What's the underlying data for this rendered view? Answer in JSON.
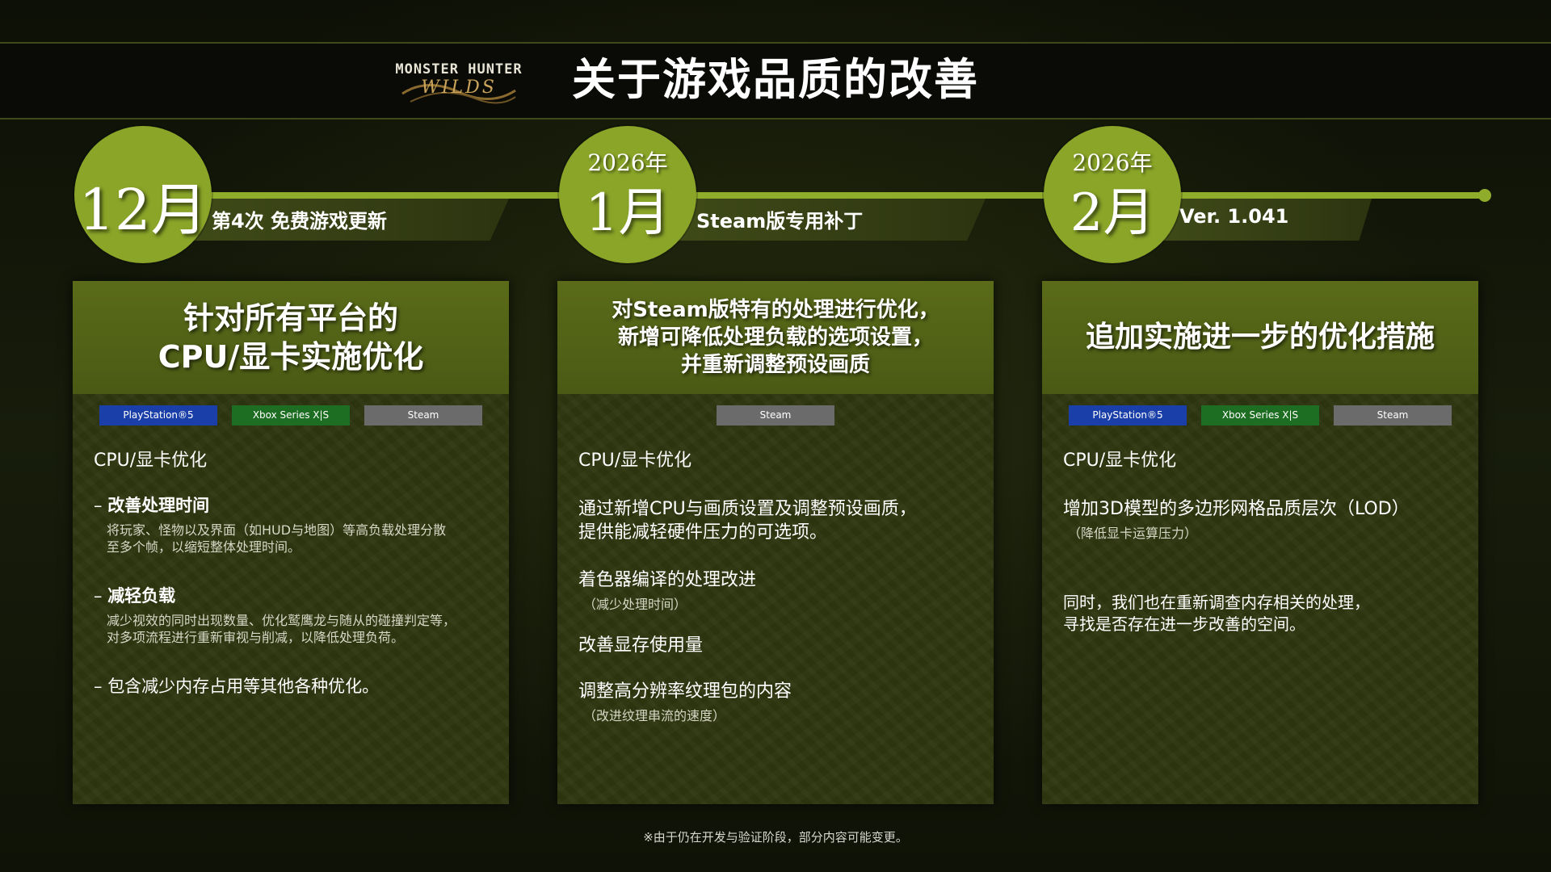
{
  "header": {
    "logo_line1": "MONSTER HUNTER",
    "logo_line2": "WILDS",
    "title": "关于游戏品质的改善"
  },
  "timeline": [
    {
      "year": "",
      "month": "12月",
      "label": "第4次 免费游戏更新"
    },
    {
      "year": "2026年",
      "month": "1月",
      "label": "Steam版专用补丁"
    },
    {
      "year": "2026年",
      "month": "2月",
      "label": "Ver. 1.041"
    }
  ],
  "panels": [
    {
      "heading_lines": [
        "针对所有平台的",
        "CPU/显卡实施优化"
      ],
      "tags": [
        "PlayStation®5",
        "Xbox Series X|S",
        "Steam"
      ],
      "section_title": "CPU/显卡优化",
      "items": [
        {
          "title": "改善处理时间",
          "desc_lines": [
            "将玩家、怪物以及界面（如HUD与地图）等高负载处理分散",
            "至多个帧，以缩短整体处理时间。"
          ]
        },
        {
          "title": "减轻负载",
          "desc_lines": [
            "减少视效的同时出现数量、优化鹫鹰龙与随从的碰撞判定等，",
            "对多项流程进行重新审视与削减，以降低处理负荷。"
          ]
        },
        {
          "title": "包含减少内存占用等其他各种优化。"
        }
      ]
    },
    {
      "heading_lines": [
        "对Steam版特有的处理进行优化，",
        "新增可降低处理负载的选项设置，",
        "并重新调整预设画质"
      ],
      "tags": [
        "Steam"
      ],
      "section_title": "CPU/显卡优化",
      "items": [
        {
          "lines": [
            "通过新增CPU与画质设置及调整预设画质，",
            "提供能减轻硬件压力的可选项。"
          ]
        },
        {
          "lines": [
            "着色器编译的处理改进"
          ],
          "sub": "（减少处理时间）"
        },
        {
          "lines": [
            "改善显存使用量"
          ]
        },
        {
          "lines": [
            "调整高分辨率纹理包的内容"
          ],
          "sub": "（改进纹理串流的速度）"
        }
      ]
    },
    {
      "heading_lines": [
        "追加实施进一步的优化措施"
      ],
      "tags": [
        "PlayStation®5",
        "Xbox Series X|S",
        "Steam"
      ],
      "section_title": "CPU/显卡优化",
      "items": [
        {
          "lines": [
            "增加3D模型的多边形网格品质层次（LOD）"
          ],
          "sub": "（降低显卡运算压力）"
        },
        {
          "lines": [
            "同时，我们也在重新调查内存相关的处理，",
            "寻找是否存在进一步改善的空间。"
          ]
        }
      ]
    }
  ],
  "footer": "※由于仍在开发与验证阶段，部分内容可能变更。",
  "colors": {
    "accent_green": "#8fad2a",
    "ps_blue": "#1a3fa8",
    "xbox_green": "#1d6d22",
    "steam_gray": "#6b6b6b"
  }
}
